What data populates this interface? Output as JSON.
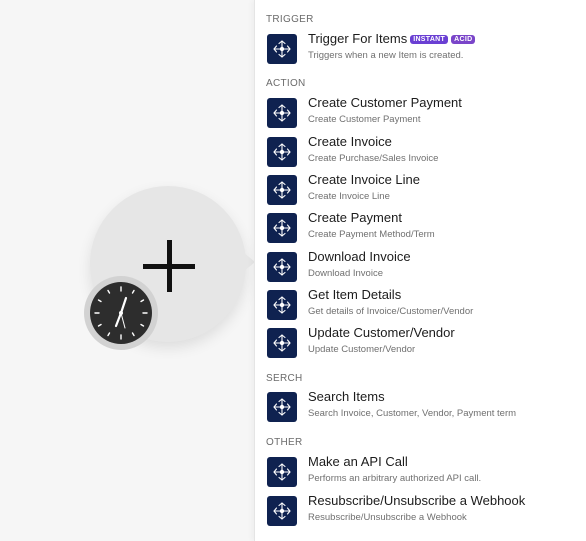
{
  "sections": [
    {
      "title": "TRIGGER",
      "items": [
        {
          "title": "Trigger For Items",
          "subtitle": "Triggers when a new Item is created.",
          "badges": [
            "INSTANT",
            "ACID"
          ]
        }
      ]
    },
    {
      "title": "ACTION",
      "items": [
        {
          "title": "Create Customer Payment",
          "subtitle": "Create Customer Payment"
        },
        {
          "title": "Create Invoice",
          "subtitle": "Create Purchase/Sales Invoice"
        },
        {
          "title": "Create Invoice Line",
          "subtitle": "Create Invoice Line"
        },
        {
          "title": "Create Payment",
          "subtitle": "Create Payment Method/Term"
        },
        {
          "title": "Download Invoice",
          "subtitle": "Download Invoice"
        },
        {
          "title": "Get Item Details",
          "subtitle": "Get details of Invoice/Customer/Vendor"
        },
        {
          "title": "Update Customer/Vendor",
          "subtitle": "Update Customer/Vendor"
        }
      ]
    },
    {
      "title": "SERCH",
      "items": [
        {
          "title": "Search Items",
          "subtitle": "Search Invoice, Customer, Vendor, Payment term"
        }
      ]
    },
    {
      "title": "OTHER",
      "items": [
        {
          "title": "Make an API Call",
          "subtitle": "Performs an arbitrary authorized API call."
        },
        {
          "title": "Resubscribe/Unsubscribe a Webhook",
          "subtitle": "Resubscribe/Unsubscribe a Webhook"
        }
      ]
    }
  ],
  "colors": {
    "icon_bg": "#0f2250",
    "badge": "#6a3fd3",
    "canvas": "#f6f6f6"
  },
  "icons": {
    "module": "app-module-icon",
    "add": "plus-icon",
    "schedule": "clock-icon"
  }
}
